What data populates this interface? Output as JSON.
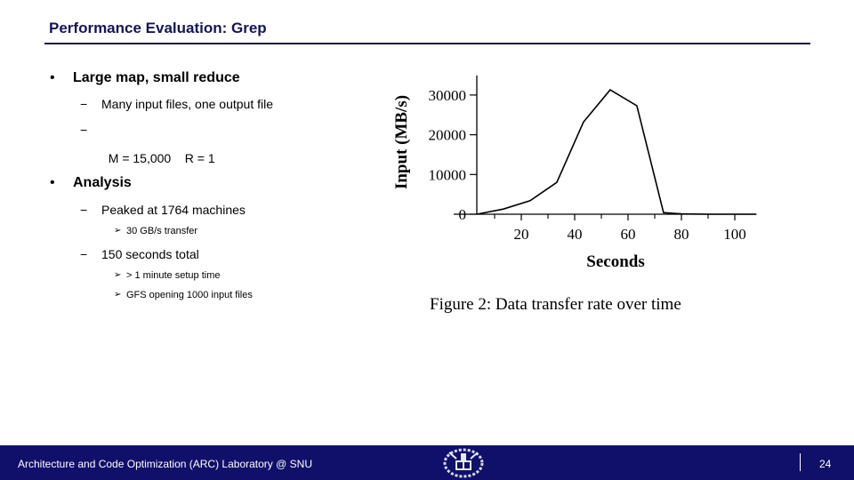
{
  "slide": {
    "title": "Performance Evaluation: Grep",
    "bullets": [
      {
        "label": "Large map, small reduce",
        "children": [
          {
            "label": "Many input files, one output file",
            "children": []
          },
          {
            "label": "M = 15,000    R = 1",
            "children": []
          }
        ]
      },
      {
        "label": "Analysis",
        "children": [
          {
            "label": "Peaked at 1764 machines",
            "children": [
              {
                "label": "30 GB/s transfer"
              }
            ]
          },
          {
            "label": "150 seconds total",
            "children": [
              {
                "label": "> 1 minute setup time"
              },
              {
                "label": "GFS opening 1000 input files"
              }
            ]
          }
        ]
      }
    ],
    "bullet_glyph": "•",
    "dash_glyph": "−",
    "arrow_glyph": "➢",
    "figure_caption": "Figure 2: Data transfer rate over time"
  },
  "footer": {
    "lab_name": "Architecture and Code Optimization (ARC) Laboratory @ SNU",
    "logo_icon": "snu-emblem-icon",
    "page_number": "24",
    "background_color": "#10106a"
  },
  "chart_data": {
    "type": "line",
    "title": "",
    "xlabel": "Seconds",
    "ylabel": "Input (MB/s)",
    "xlim": [
      0,
      108
    ],
    "ylim": [
      0,
      35000
    ],
    "x_ticks": [
      20,
      40,
      60,
      80,
      100
    ],
    "x_minor_ticks": [
      10,
      30,
      50,
      70,
      90
    ],
    "y_ticks": [
      0,
      10000,
      20000,
      30000
    ],
    "grid": false,
    "legend": "none",
    "series": [
      {
        "name": "Input",
        "x": [
          3.3,
          13.3,
          23.3,
          33.3,
          43.3,
          53.3,
          63.3,
          73.3,
          80,
          90,
          108
        ],
        "values": [
          0,
          1300,
          3400,
          8000,
          23200,
          31300,
          27300,
          400,
          100,
          0,
          0
        ]
      }
    ]
  }
}
